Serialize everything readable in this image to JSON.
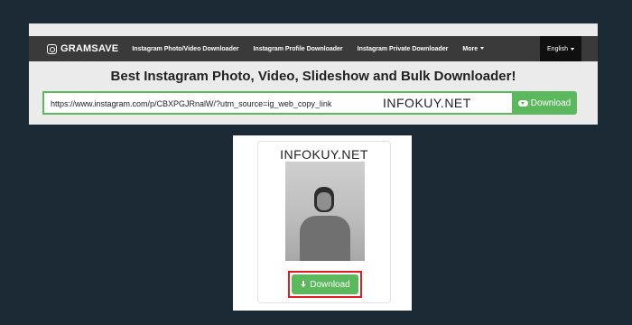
{
  "navbar": {
    "brand": "GRAMSAVE",
    "links": [
      "Instagram Photo/Video Downloader",
      "Instagram Profile Downloader",
      "Instagram Private Downloader",
      "More"
    ],
    "language": "English"
  },
  "main": {
    "heading": "Best Instagram Photo, Video, Slideshow and Bulk Downloader!",
    "url_value": "https://www.instagram.com/p/CBXPGJRnalW/?utm_source=ig_web_copy_link",
    "download_label": "Download",
    "watermark": "INFOKUY.NET"
  },
  "result": {
    "watermark": "INFOKUY.NET",
    "download_label": "Download"
  },
  "colors": {
    "accent_green": "#5cb85c",
    "highlight_red": "#e31b23",
    "navbar_bg": "#3a3a3a",
    "page_bg": "#1b2a35"
  }
}
